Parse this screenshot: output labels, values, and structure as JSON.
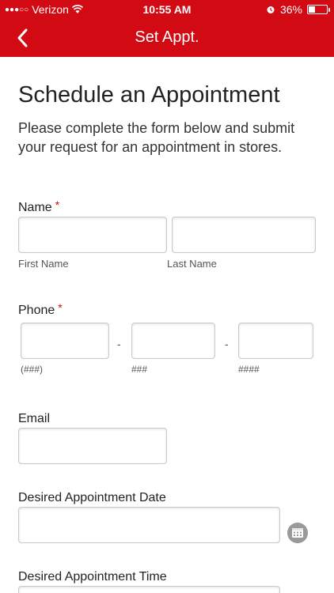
{
  "status_bar": {
    "signal": "●●●○○",
    "carrier": "Verizon",
    "time": "10:55 AM",
    "battery": "36%",
    "battery_level": 0.36
  },
  "nav": {
    "title": "Set Appt."
  },
  "page": {
    "heading": "Schedule an Appointment",
    "intro": "Please complete the form below and submit your request for an appointment in stores."
  },
  "form": {
    "name_label": "Name",
    "required_mark": "*",
    "first_name_hint": "First Name",
    "last_name_hint": "Last Name",
    "phone_label": "Phone",
    "phone_area_hint": "(###)",
    "phone_prefix_hint": "###",
    "phone_line_hint": "####",
    "phone_separator": "-",
    "email_label": "Email",
    "date_label": "Desired Appointment Date",
    "time_label": "Desired Appointment Time"
  }
}
